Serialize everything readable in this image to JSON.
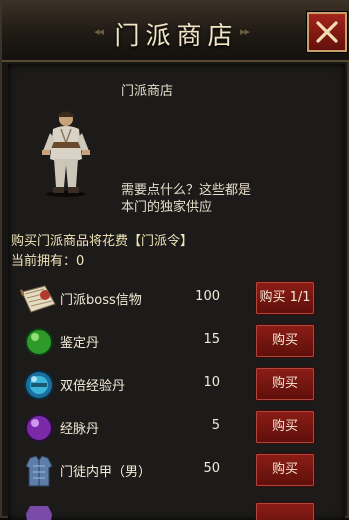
{
  "header": {
    "title": "门派商店",
    "left_deco": "◂◂",
    "right_deco": "▸▸"
  },
  "npc": {
    "name": "门派商店",
    "dialogue": "需要点什么？这些都是本门的独家供应"
  },
  "shop": {
    "cost_text": "购买门派商品将花费【门派令】",
    "owned_text": "当前拥有：0",
    "items": [
      {
        "name": "门派boss信物",
        "price": "100",
        "button": "购买 1/1",
        "icon": "scroll-icon"
      },
      {
        "name": "鉴定丹",
        "price": "15",
        "button": "购买",
        "icon": "green-pill-icon"
      },
      {
        "name": "双倍经验丹",
        "price": "10",
        "button": "购买",
        "icon": "blue-orb-icon"
      },
      {
        "name": "经脉丹",
        "price": "5",
        "button": "购买",
        "icon": "purple-pill-icon"
      },
      {
        "name": "门徒内甲（男）",
        "price": "50",
        "button": "购买",
        "icon": "armor-icon"
      }
    ]
  },
  "colors": {
    "accent": "#8c1d16",
    "text": "#e6ddc9",
    "gold_text": "#f0e3b8"
  }
}
